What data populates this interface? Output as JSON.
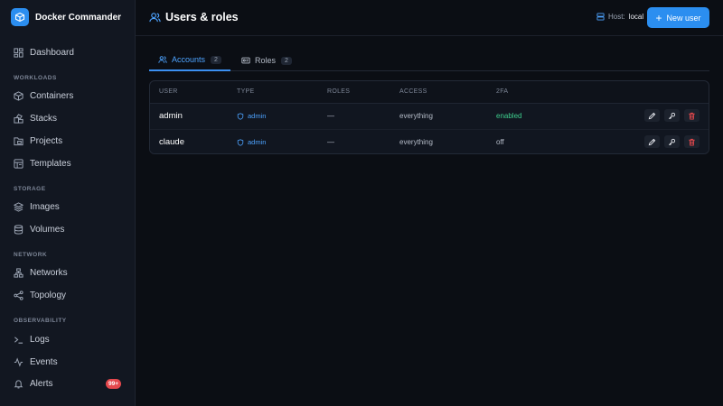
{
  "app": {
    "name": "Docker Commander"
  },
  "sidebar": {
    "top_items": [
      {
        "label": "Dashboard",
        "icon": "dashboard-icon"
      }
    ],
    "sections": [
      {
        "label": "WORKLOADS",
        "items": [
          {
            "label": "Containers",
            "icon": "containers-icon"
          },
          {
            "label": "Stacks",
            "icon": "stacks-icon"
          },
          {
            "label": "Projects",
            "icon": "projects-icon"
          },
          {
            "label": "Templates",
            "icon": "templates-icon"
          }
        ]
      },
      {
        "label": "STORAGE",
        "items": [
          {
            "label": "Images",
            "icon": "layers-icon"
          },
          {
            "label": "Volumes",
            "icon": "database-icon"
          }
        ]
      },
      {
        "label": "NETWORK",
        "items": [
          {
            "label": "Networks",
            "icon": "network-icon"
          },
          {
            "label": "Topology",
            "icon": "share-icon"
          }
        ]
      },
      {
        "label": "OBSERVABILITY",
        "items": [
          {
            "label": "Logs",
            "icon": "terminal-icon"
          },
          {
            "label": "Events",
            "icon": "activity-icon"
          },
          {
            "label": "Alerts",
            "icon": "bell-icon",
            "badge": "99+"
          }
        ]
      }
    ]
  },
  "header": {
    "title": "Users & roles",
    "host_label": "Host:",
    "host_value": "local",
    "new_user_label": "New user"
  },
  "tabs": [
    {
      "label": "Accounts",
      "count": "2",
      "active": true
    },
    {
      "label": "Roles",
      "count": "2",
      "active": false
    }
  ],
  "table": {
    "columns": [
      "USER",
      "TYPE",
      "ROLES",
      "ACCESS",
      "2FA"
    ],
    "rows": [
      {
        "user": "admin",
        "type": "admin",
        "roles": "—",
        "access": "everything",
        "tfa": "enabled"
      },
      {
        "user": "claude",
        "type": "admin",
        "roles": "—",
        "access": "everything",
        "tfa": "off"
      }
    ]
  },
  "colors": {
    "accent": "#2b8ef0",
    "success": "#3ecf8e",
    "danger": "#e5484d",
    "background": "#0b0e14",
    "sidebar": "#121721"
  }
}
